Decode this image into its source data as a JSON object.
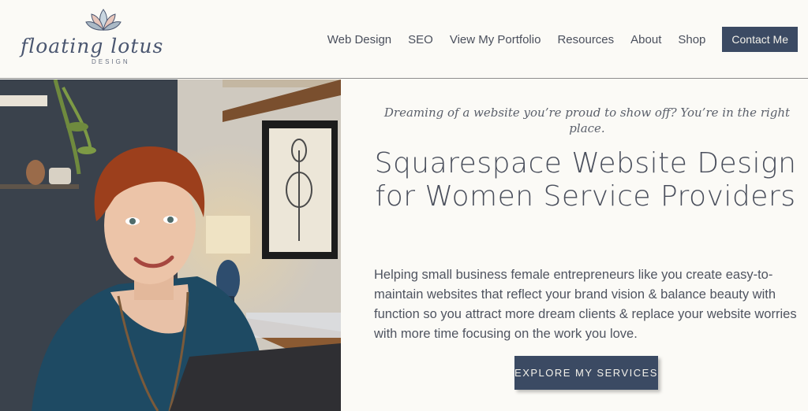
{
  "brand": {
    "script": "floating lotus",
    "sub": "DESIGN"
  },
  "nav": {
    "items": [
      "Web Design",
      "SEO",
      "View My Portfolio",
      "Resources",
      "About",
      "Shop"
    ],
    "contact_label": "Contact Me"
  },
  "hero": {
    "tagline": "Dreaming of a website you’re proud to show off? You’re in the right place.",
    "headline": "Squarespace Website Design for Women Service Providers",
    "description": "Helping small business female entrepreneurs like you create easy-to-maintain websites that reflect your brand vision & balance beauty with function so you attract more dream clients & replace your website worries with more time focusing on the work you love.",
    "cta_label": "EXPLORE MY SERVICES"
  },
  "colors": {
    "background": "#fbfaf6",
    "accent": "#3b4a63",
    "text": "#4a4f5c"
  },
  "icons": {
    "logo": "lotus-icon"
  }
}
